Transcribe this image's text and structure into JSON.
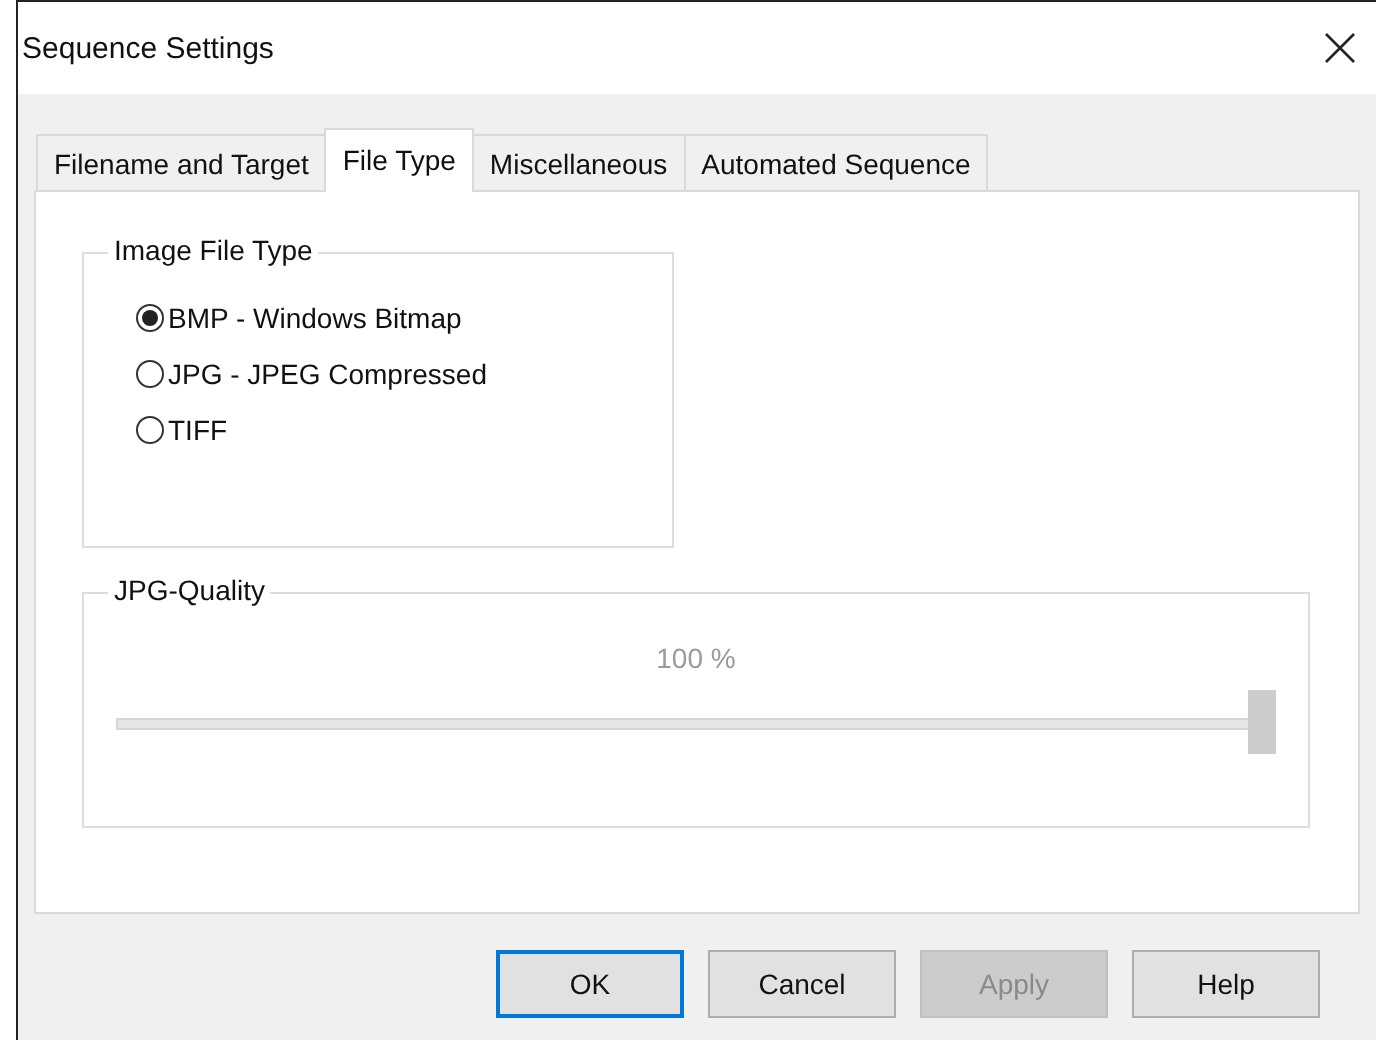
{
  "window": {
    "title": "Sequence Settings"
  },
  "tabs": [
    {
      "label": "Filename and Target",
      "selected": false
    },
    {
      "label": "File Type",
      "selected": true
    },
    {
      "label": "Miscellaneous",
      "selected": false
    },
    {
      "label": "Automated Sequence",
      "selected": false
    }
  ],
  "image_file_type": {
    "title": "Image File Type",
    "options": [
      {
        "label": "BMP - Windows Bitmap",
        "selected": true
      },
      {
        "label": "JPG - JPEG Compressed",
        "selected": false
      },
      {
        "label": "TIFF",
        "selected": false
      }
    ]
  },
  "jpg_quality": {
    "title": "JPG-Quality",
    "disabled": true,
    "reading": "100 %",
    "level": 1
  },
  "buttons": [
    {
      "label": "OK",
      "default": true,
      "disabled": false
    },
    {
      "label": "Cancel",
      "default": false,
      "disabled": false
    },
    {
      "label": "Apply",
      "default": false,
      "disabled": true
    },
    {
      "label": "Help",
      "default": false,
      "disabled": false
    }
  ]
}
